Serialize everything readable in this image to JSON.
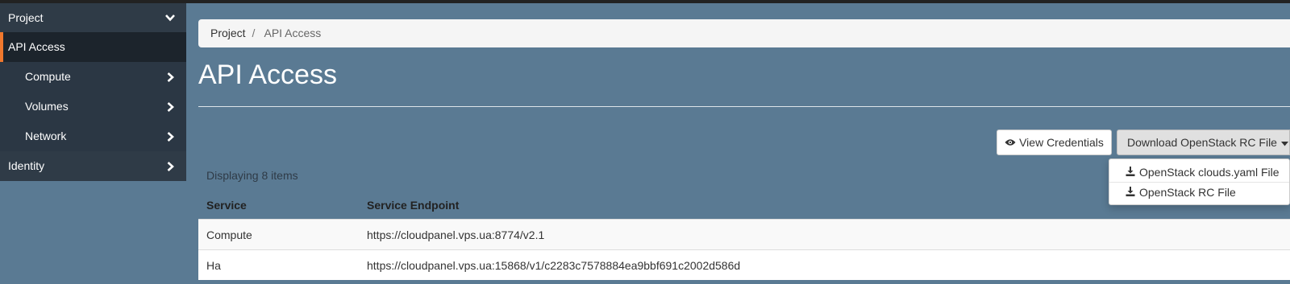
{
  "sidebar": {
    "project_label": "Project",
    "active_label": "API Access",
    "items": [
      {
        "label": "Compute"
      },
      {
        "label": "Volumes"
      },
      {
        "label": "Network"
      }
    ],
    "identity_label": "Identity",
    "accent_color": "#f0782d"
  },
  "breadcrumb": {
    "root": "Project",
    "separator": "/",
    "current": "API Access"
  },
  "page": {
    "title": "API Access"
  },
  "actions": {
    "view_credentials": "View Credentials",
    "download_rc": "Download OpenStack RC File",
    "dropdown": [
      {
        "label": "OpenStack clouds.yaml File"
      },
      {
        "label": "OpenStack RC File"
      }
    ]
  },
  "table": {
    "count_text": "Displaying 8 items",
    "headers": [
      "Service",
      "Service Endpoint"
    ],
    "rows": [
      {
        "service": "Compute",
        "endpoint": "https://cloudpanel.vps.ua:8774/v2.1"
      },
      {
        "service": "Ha",
        "endpoint": "https://cloudpanel.vps.ua:15868/v1/c2283c7578884ea9bbf691c2002d586d"
      }
    ]
  }
}
